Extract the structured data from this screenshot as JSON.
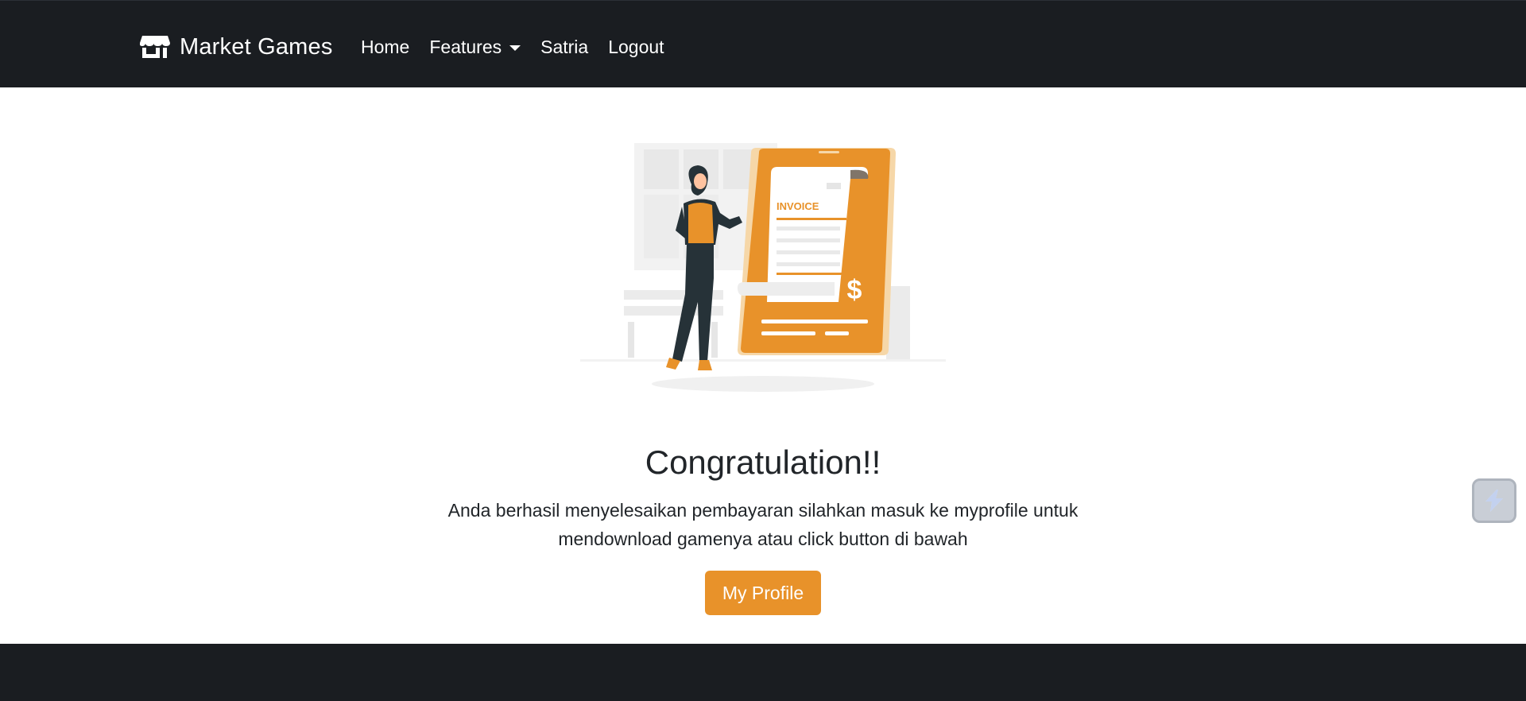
{
  "nav": {
    "brand": "Market Games",
    "brand_icon": "shop-icon",
    "items": [
      {
        "label": "Home"
      },
      {
        "label": "Features",
        "dropdown": true
      },
      {
        "label": "Satria"
      },
      {
        "label": "Logout"
      }
    ]
  },
  "illustration": {
    "invoice_label": "INVOICE",
    "currency_symbol": "$"
  },
  "main": {
    "title": "Congratulation!!",
    "description": "Anda berhasil menyelesaikan pembayaran silahkan masuk ke myprofile untuk mendownload gamenya atau click button di bawah",
    "button_label": "My Profile"
  },
  "floating_widget_icon": "lightning-icon",
  "colors": {
    "navbar": "#1a1d21",
    "accent": "#e8922a",
    "text": "#212529"
  }
}
